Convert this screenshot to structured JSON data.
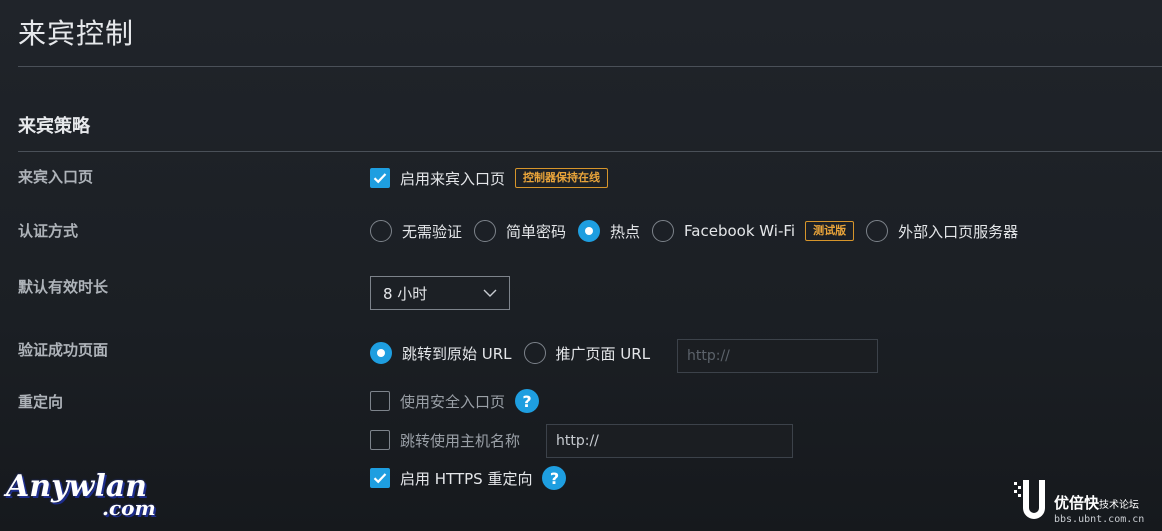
{
  "page": {
    "title": "来宾控制"
  },
  "section": {
    "title": "来宾策略"
  },
  "portal": {
    "label": "来宾入口页",
    "enable_label": "启用来宾入口页",
    "enable_checked": true,
    "badge": "控制器保持在线"
  },
  "auth": {
    "label": "认证方式",
    "options": [
      {
        "label": "无需验证",
        "checked": false
      },
      {
        "label": "简单密码",
        "checked": false
      },
      {
        "label": "热点",
        "checked": true
      },
      {
        "label": "Facebook Wi-Fi",
        "checked": false
      },
      {
        "label": "外部入口页服务器",
        "checked": false
      }
    ],
    "facebook_badge": "测试版"
  },
  "expiration": {
    "label": "默认有效时长",
    "selected": "8 小时"
  },
  "landing": {
    "label": "验证成功页面",
    "options": [
      {
        "label": "跳转到原始 URL",
        "checked": true
      },
      {
        "label": "推广页面 URL",
        "checked": false
      }
    ],
    "url_placeholder": "http://"
  },
  "redirect": {
    "label": "重定向",
    "secure_portal_label": "使用安全入口页",
    "secure_portal_checked": false,
    "hostname_label": "跳转使用主机名称",
    "hostname_checked": false,
    "hostname_value": "http://",
    "https_label": "启用 HTTPS 重定向",
    "https_checked": true,
    "help": "?"
  },
  "watermarks": {
    "left_main": "Anywlan",
    "left_sub": ".com",
    "right_brand": "优倍快",
    "right_sub": "技术论坛",
    "right_url": "bbs.ubnt.com.cn"
  },
  "colors": {
    "accent": "#1e9ee0",
    "badge": "#e9a43a",
    "background": "#1d2126"
  }
}
